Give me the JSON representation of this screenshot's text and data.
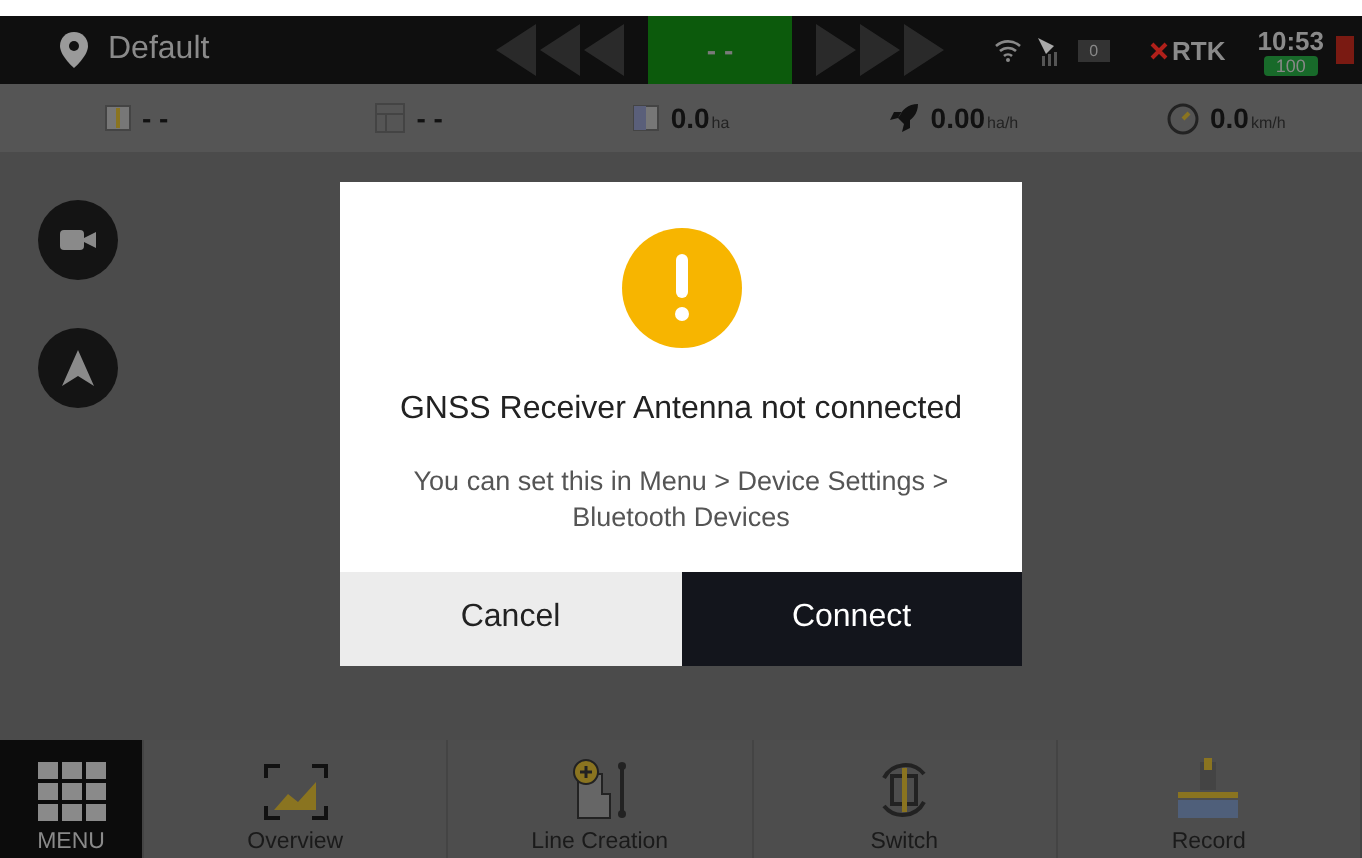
{
  "top_bar": {
    "location": "Default",
    "guidance_value": "- -",
    "satellite_count": "0",
    "rtk_label": "RTK",
    "rtk_connected": false,
    "time": "10:53",
    "battery": "100"
  },
  "stats": [
    {
      "kind": "field",
      "value": "- -"
    },
    {
      "kind": "area",
      "value": "- -"
    },
    {
      "kind": "worked",
      "value": "0.0",
      "unit": "ha"
    },
    {
      "kind": "rate",
      "value": "0.00",
      "unit": "ha/h"
    },
    {
      "kind": "speed",
      "value": "0.0",
      "unit": "km/h"
    }
  ],
  "map_buttons": [
    {
      "kind": "camera"
    },
    {
      "kind": "navigate"
    }
  ],
  "dialog": {
    "title": "GNSS Receiver Antenna not connected",
    "message": "You can set this in Menu > Device Settings > Bluetooth Devices",
    "buttons": [
      {
        "label": "Cancel",
        "primary": false
      },
      {
        "label": "Connect",
        "primary": true
      }
    ]
  },
  "bottom_nav": [
    {
      "kind": "menu",
      "label": "MENU",
      "selected": true
    },
    {
      "kind": "overview",
      "label": "Overview",
      "selected": false
    },
    {
      "kind": "line",
      "label": "Line Creation",
      "selected": false
    },
    {
      "kind": "switch",
      "label": "Switch",
      "selected": false
    },
    {
      "kind": "record",
      "label": "Record",
      "selected": false
    }
  ]
}
